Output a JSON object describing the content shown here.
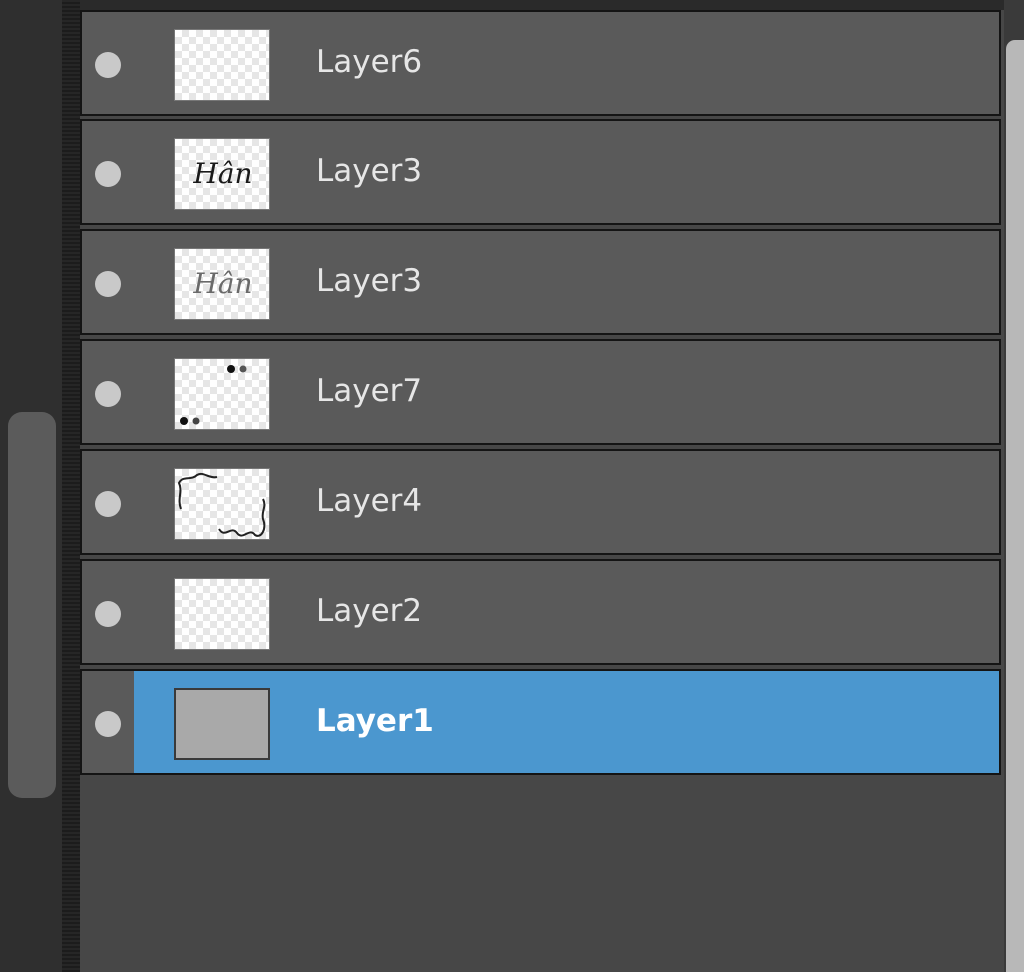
{
  "layers": [
    {
      "name": "Layer6",
      "selected": false,
      "thumb": "blank",
      "eye_icon": "visibility-dot-icon"
    },
    {
      "name": "Layer3",
      "selected": false,
      "thumb": "handwriting-dark",
      "eye_icon": "visibility-dot-icon"
    },
    {
      "name": "Layer3",
      "selected": false,
      "thumb": "handwriting-light",
      "eye_icon": "visibility-dot-icon"
    },
    {
      "name": "Layer7",
      "selected": false,
      "thumb": "dots",
      "eye_icon": "visibility-dot-icon"
    },
    {
      "name": "Layer4",
      "selected": false,
      "thumb": "squiggles",
      "eye_icon": "visibility-dot-icon"
    },
    {
      "name": "Layer2",
      "selected": false,
      "thumb": "blank",
      "eye_icon": "visibility-dot-icon"
    },
    {
      "name": "Layer1",
      "selected": true,
      "thumb": "solid-gray",
      "eye_icon": "visibility-dot-icon"
    }
  ],
  "thumb_handwriting_text": "Hân",
  "colors": {
    "row_background": "#5a5a5a",
    "selected_background": "#4b97cf",
    "panel_background": "#474747"
  }
}
